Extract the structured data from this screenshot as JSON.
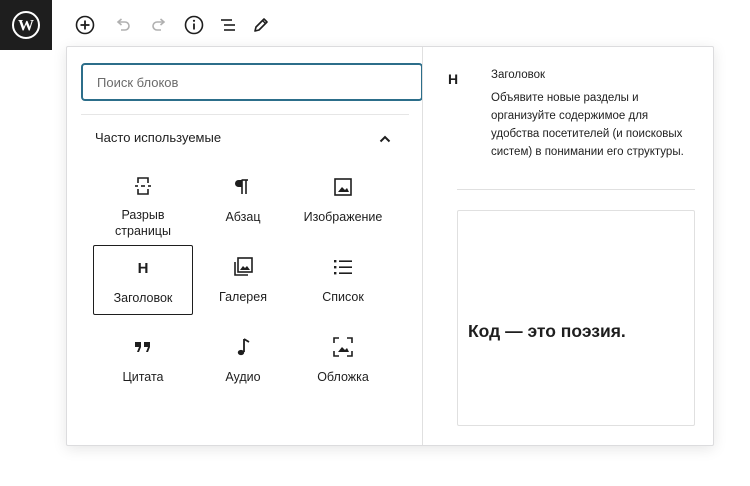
{
  "toolbar": {
    "logo_icon": "wordpress-logo-icon",
    "buttons": [
      "add-block-icon",
      "undo-icon",
      "redo-icon",
      "info-icon",
      "list-view-icon",
      "edit-pencil-icon"
    ]
  },
  "inserter": {
    "search": {
      "placeholder": "Поиск блоков",
      "value": ""
    },
    "panel": {
      "title": "Часто используемые",
      "expanded": true
    },
    "blocks": [
      {
        "label": "Разрыв\nстраницы",
        "icon": "page-break-icon"
      },
      {
        "label": "Абзац",
        "icon": "paragraph-icon"
      },
      {
        "label": "Изображение",
        "icon": "image-icon"
      },
      {
        "label": "Заголовок",
        "icon": "heading-icon",
        "selected": true
      },
      {
        "label": "Галерея",
        "icon": "gallery-icon"
      },
      {
        "label": "Список",
        "icon": "list-icon"
      },
      {
        "label": "Цитата",
        "icon": "quote-icon"
      },
      {
        "label": "Аудио",
        "icon": "audio-icon"
      },
      {
        "label": "Обложка",
        "icon": "cover-icon"
      }
    ]
  },
  "preview": {
    "icon_letter": "H",
    "title": "Заголовок",
    "description": "Объявите новые разделы и организуйте содержимое для удобства посетителей (и поисковых систем) в понимании его структуры.",
    "sample_text": "Код — это поэзия."
  },
  "colors": {
    "accent": "#2c6e8a",
    "logo_bg": "#1e1e1e",
    "text": "#1e1e1e",
    "disabled": "#b0b0b0"
  }
}
